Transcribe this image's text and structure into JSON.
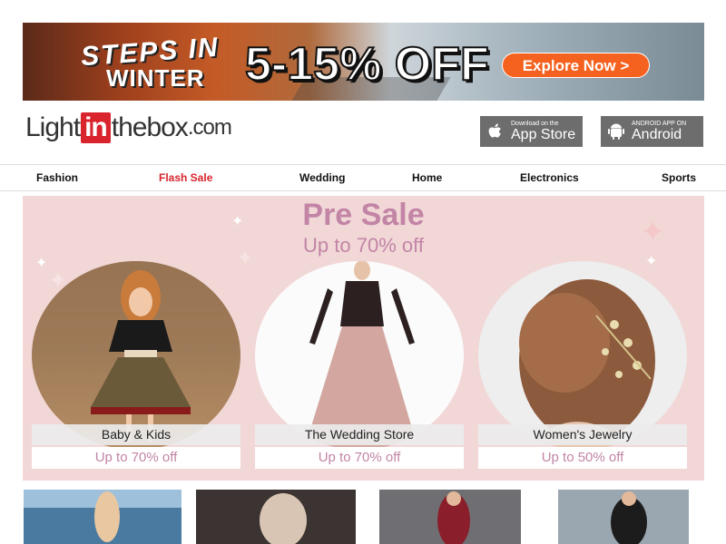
{
  "banner": {
    "line1": "STEPS IN",
    "line2": "WINTER",
    "discount": "5-15% OFF",
    "cta": "Explore Now >"
  },
  "logo": {
    "part1": "Light",
    "part2": "in",
    "part3": "thebox",
    "part4": ".com"
  },
  "apps": {
    "ios_small": "Download on the",
    "ios_big": "App Store",
    "android_small": "ANDROID APP ON",
    "android_big": "Android"
  },
  "nav": {
    "items": [
      "Fashion",
      "Flash Sale",
      "Wedding",
      "Home",
      "Electronics",
      "Sports"
    ]
  },
  "presale": {
    "title": "Pre Sale",
    "subtitle": "Up to 70% off",
    "cards": [
      {
        "label": "Baby & Kids",
        "offer": "Up to 70% off"
      },
      {
        "label": "The Wedding Store",
        "offer": "Up to 70% off"
      },
      {
        "label": "Women's Jewelry",
        "offer": "Up to 50% off"
      }
    ]
  },
  "colors": {
    "brand_red": "#d9232d",
    "presale_pink": "#c285a6",
    "cta_orange": "#f5621f"
  },
  "icons": {
    "ios": "apple-icon",
    "android": "android-icon"
  }
}
